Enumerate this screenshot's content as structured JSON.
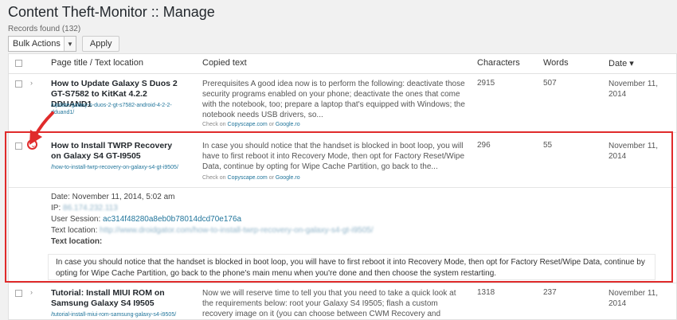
{
  "page": {
    "title": "Content Theft-Monitor :: Manage",
    "records": "Records found (132)"
  },
  "bulk": {
    "action": "Bulk Actions",
    "apply": "Apply"
  },
  "columns": {
    "title": "Page title / Text location",
    "copied": "Copied text",
    "characters": "Characters",
    "words": "Words",
    "date": "Date ▾"
  },
  "check": {
    "prefix": "Check on",
    "copyscape": "Copyscape.com",
    "or": "or",
    "google": "Google.ro"
  },
  "rows": [
    {
      "title": "How to Update Galaxy S Duos 2 GT-S7582 to KitKat 4.2.2 DDUAND1",
      "link": "/update-galaxy-s-duos-2-gt-s7582-android-4-2-2-dduand1/",
      "copied": "Prerequisites A good idea now is to perform the following: deactivate those security programs enabled on your phone; deactivate the ones that come with the notebook, too; prepare a laptop that's equipped with Windows; the notebook needs USB drivers, so...",
      "characters": "2915",
      "words": "507",
      "date": "November 11, 2014"
    },
    {
      "title": "How to Install TWRP Recovery on Galaxy S4 GT-I9505",
      "link": "/how-to-install-twrp-recovery-on-galaxy-s4-gt-i9505/",
      "copied": "In case you should notice that the handset is blocked in boot loop, you will have to first reboot it into Recovery Mode, then opt for Factory Reset/Wipe Data, continue by opting for Wipe Cache Partition, go back to the...",
      "characters": "296",
      "words": "55",
      "date": "November 11, 2014"
    },
    {
      "title": "Tutorial: Install MIUI ROM on Samsung Galaxy S4 I9505",
      "link": "/tutorial-install-miui-rom-samsung-galaxy-s4-i9505/",
      "copied": "Now we will reserve time to tell you that you need to take a quick look at the requirements below: root your Galaxy S4 I9505; flash a custom recovery image on it (you can choose between CWM Recovery and TWRP);...",
      "characters": "1318",
      "words": "237",
      "date": "November 11, 2014"
    }
  ],
  "details": {
    "date": "Date: November 11, 2014, 5:02 am",
    "ip_label": "IP:",
    "ip_value": "86.174.232.113",
    "session_label": "User Session:",
    "session_value": "ac314f48280a8eb0b78014dcd70e176a",
    "location_label": "Text location:",
    "location_value": "http://www.droidgator.com/how-to-install-twrp-recovery-on-galaxy-s4-gt-i9505/",
    "location_label2": "Text location:",
    "fulltext": "In case you should notice that the handset is blocked in boot loop, you will have to first reboot it into Recovery Mode, then opt for Factory Reset/Wipe Data, continue by opting for Wipe Cache Partition, go back to the phone's main menu when you're done and then choose the system restarting."
  },
  "icons": {
    "collapsed": "chevron-right-icon",
    "expanded": "chevron-down-icon",
    "annotation": "red-arrow-icon"
  },
  "colors": {
    "link": "#21759b",
    "highlight": "#e02b2b"
  }
}
